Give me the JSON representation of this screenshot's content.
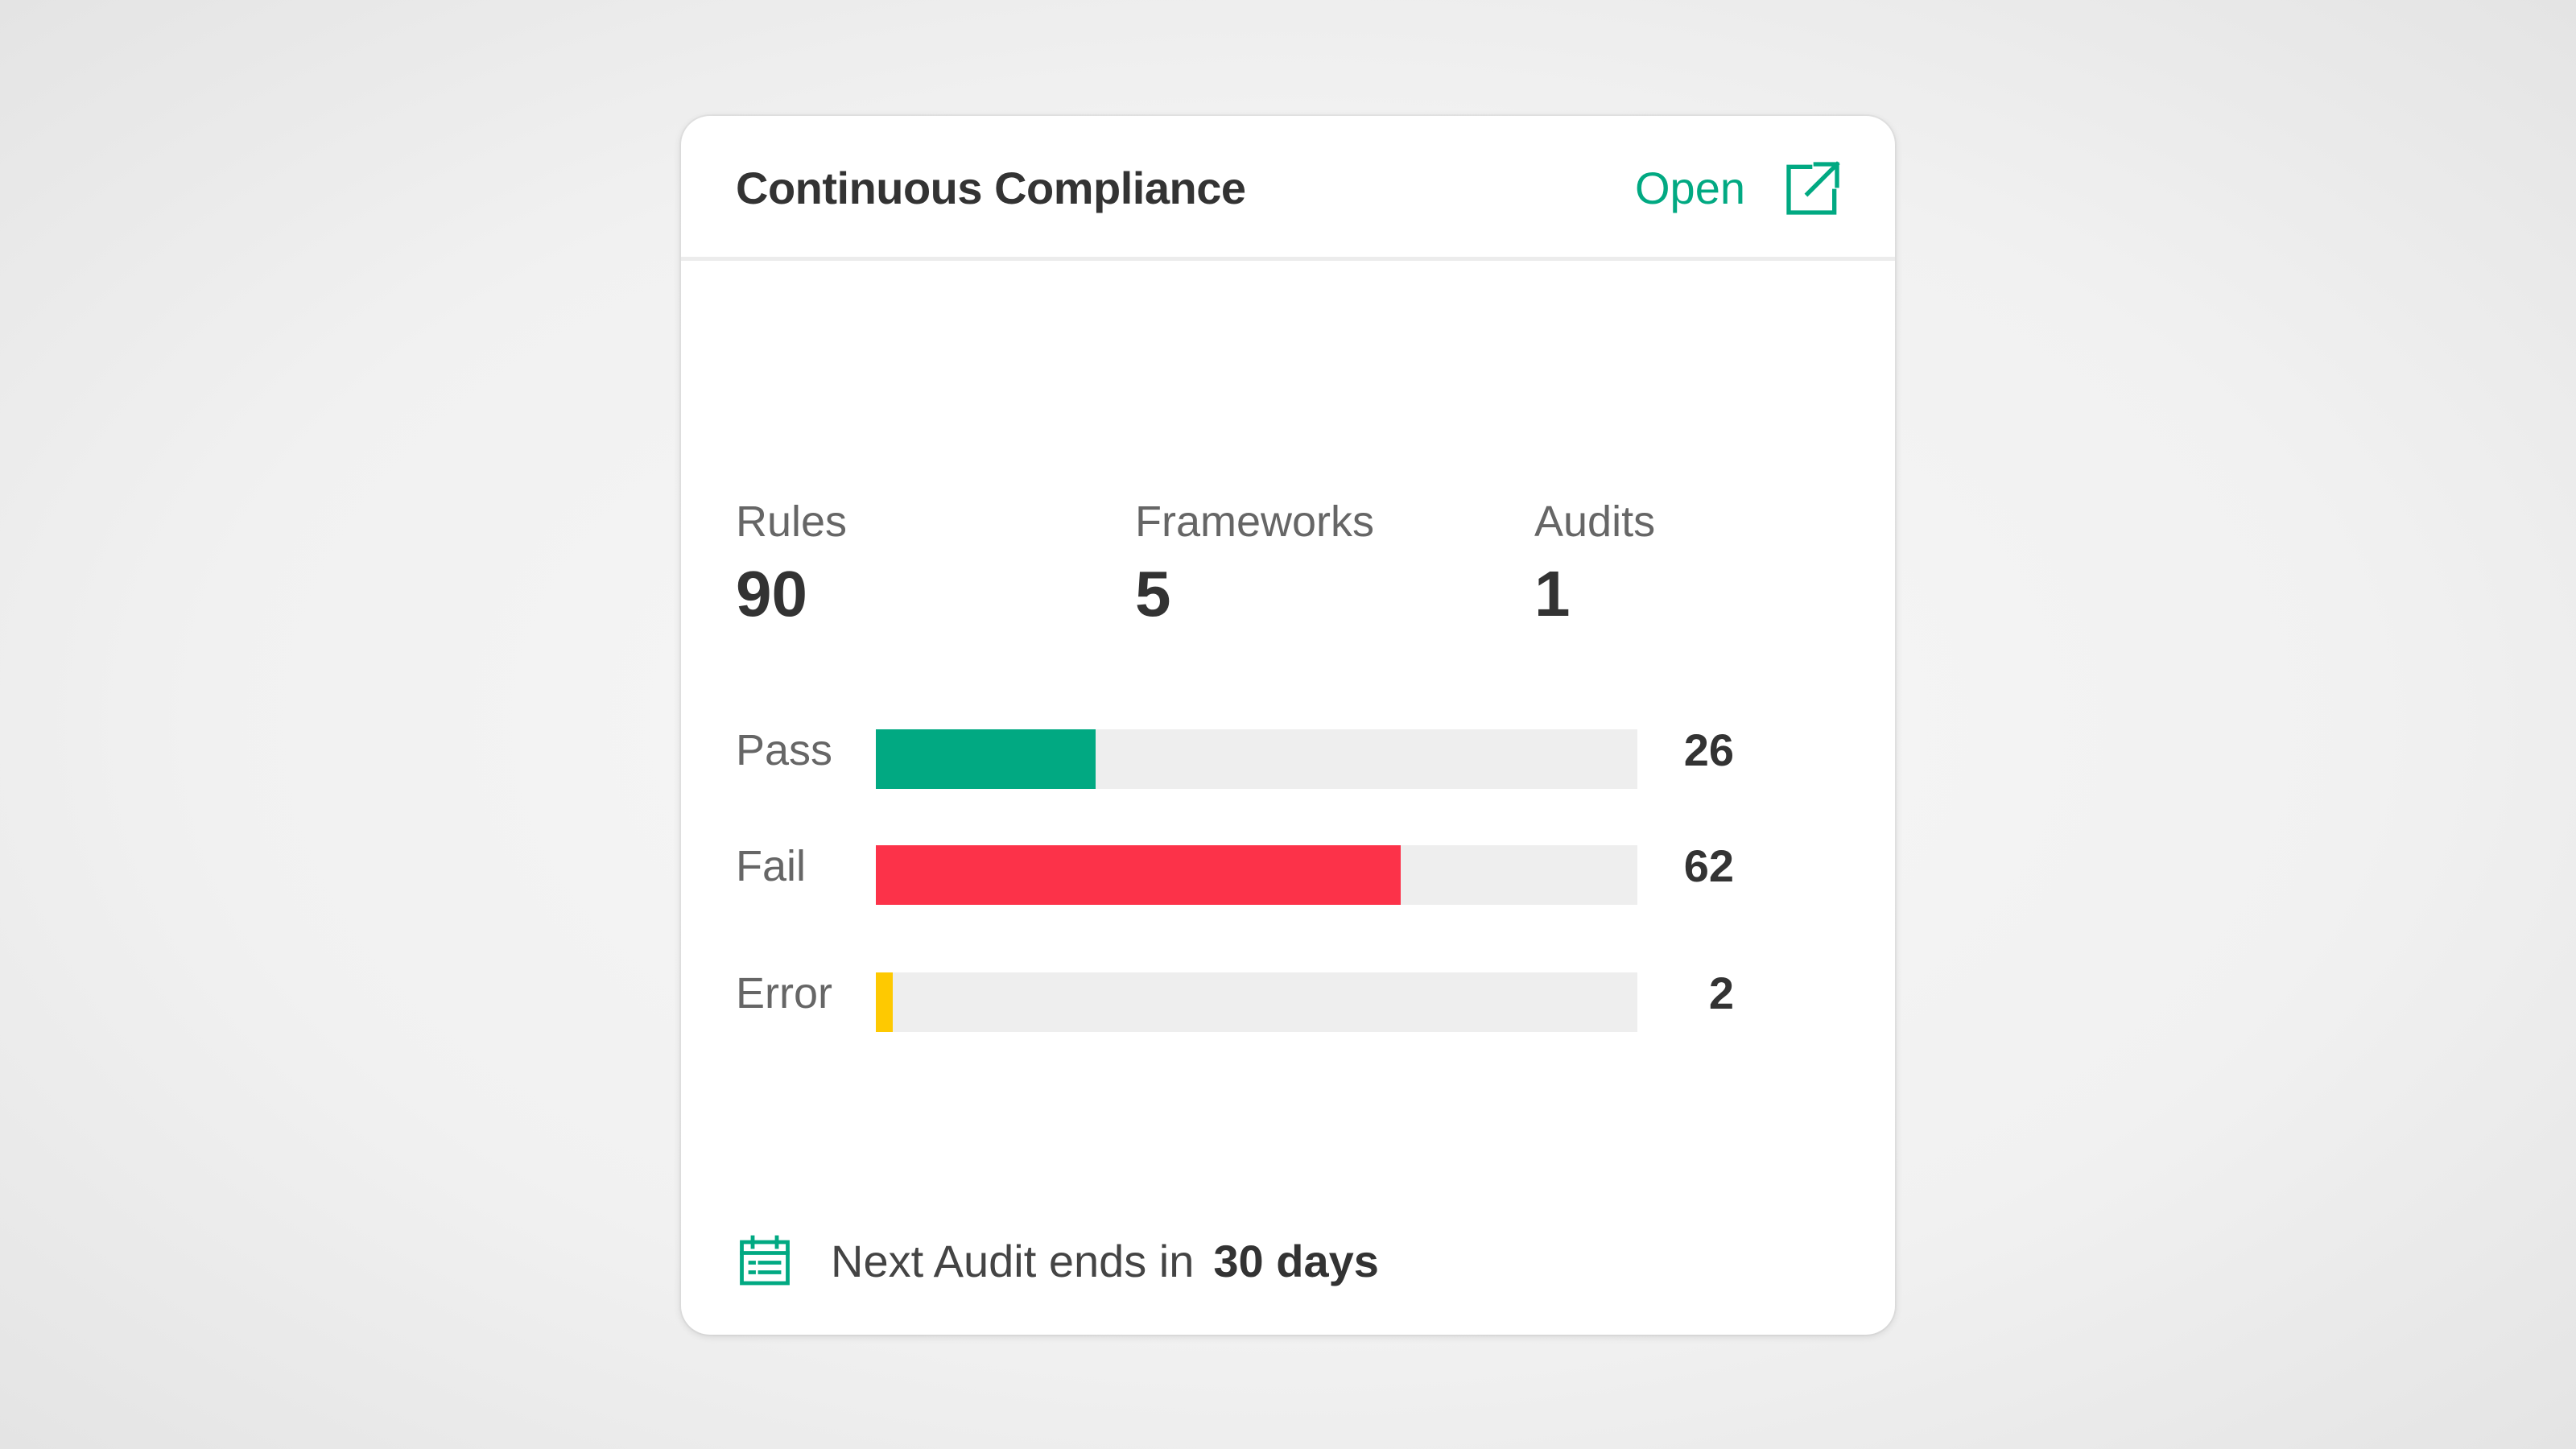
{
  "card": {
    "title": "Continuous Compliance",
    "open_label": "Open",
    "open_icon": "external-link-icon",
    "accent_color": "#01a982"
  },
  "stats": [
    {
      "label": "Rules",
      "value": "90"
    },
    {
      "label": "Frameworks",
      "value": "5"
    },
    {
      "label": "Audits",
      "value": "1"
    }
  ],
  "results": {
    "total": 90,
    "rows": [
      {
        "label": "Pass",
        "value": 26,
        "display": "26",
        "color": "#01a982"
      },
      {
        "label": "Fail",
        "value": 62,
        "display": "62",
        "color": "#fc3249"
      },
      {
        "label": "Error",
        "value": 2,
        "display": "2",
        "color": "#fec901"
      }
    ],
    "track_color": "#eeeeee"
  },
  "footer": {
    "icon": "calendar-icon",
    "text": "Next Audit ends in",
    "highlight": "30 days"
  }
}
